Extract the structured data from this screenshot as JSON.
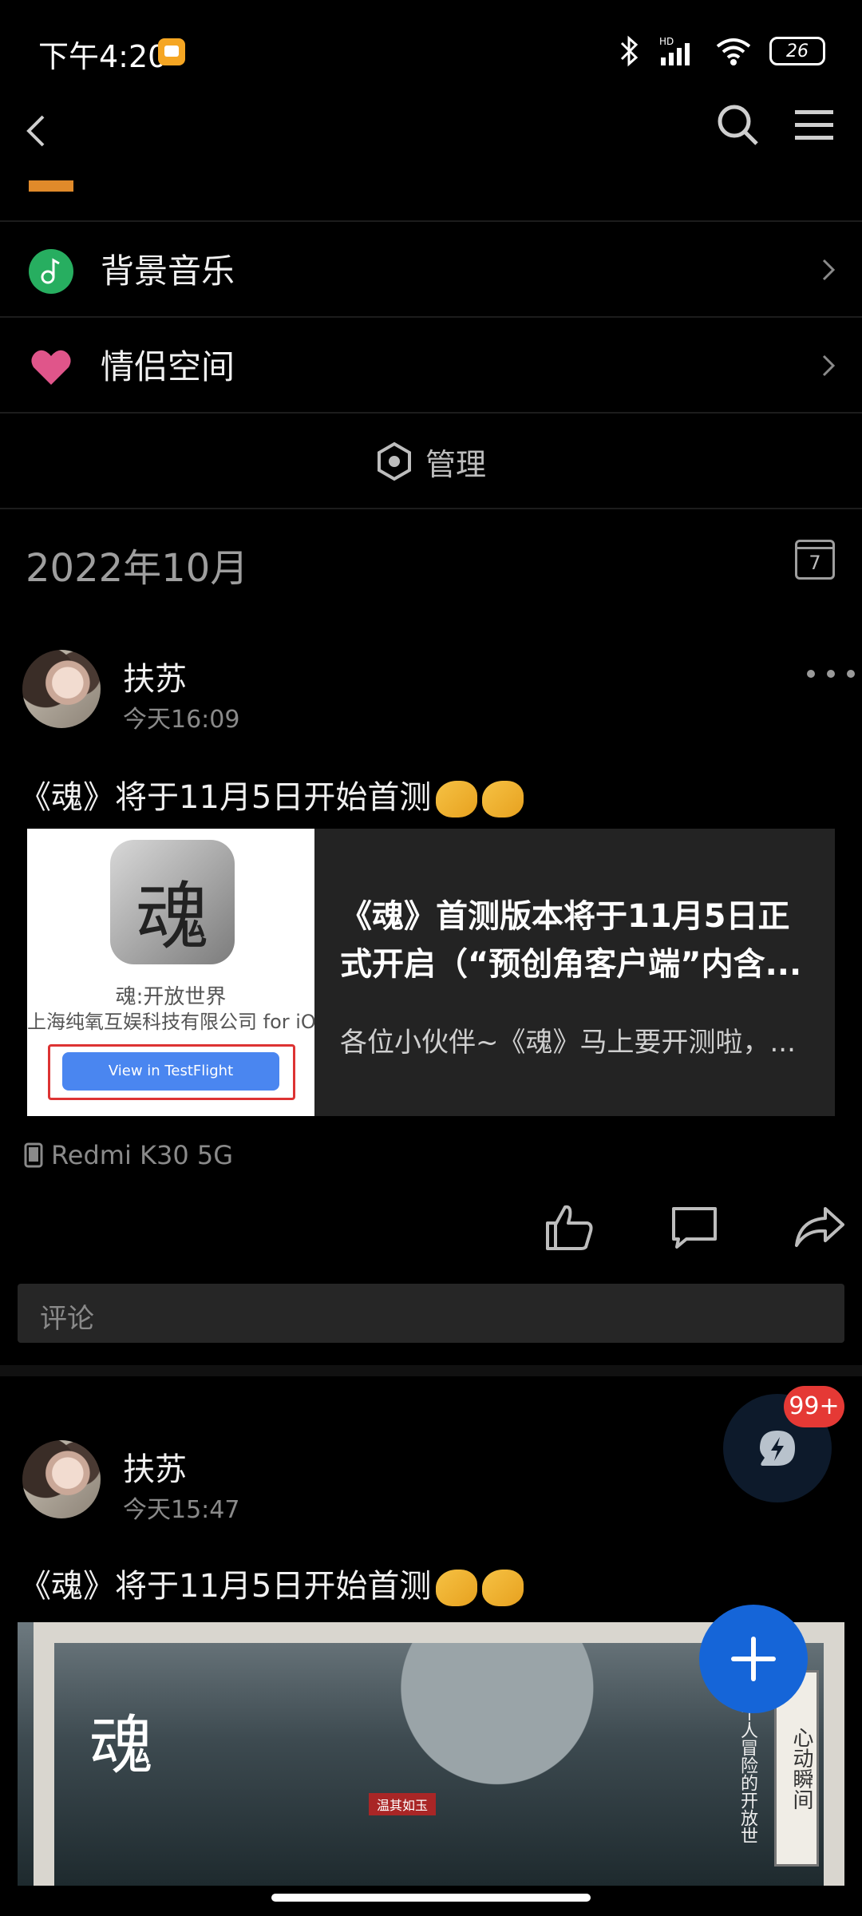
{
  "status_bar": {
    "time": "下午4:20",
    "battery": "26",
    "network": "HD"
  },
  "settings_rows": [
    {
      "label": "背景音乐",
      "icon": "music-note-icon",
      "color": "#27ae60"
    },
    {
      "label": "情侣空间",
      "icon": "heart-icon",
      "color": "#e0558a"
    }
  ],
  "manage": {
    "label": "管理"
  },
  "month": {
    "title": "2022年10月",
    "calendar_day": "7"
  },
  "posts": [
    {
      "author": "扶苏",
      "time": "今天16:09",
      "text": "《魂》将于11月5日开始首测",
      "link_card": {
        "thumb_app_glyph": "魂",
        "thumb_app_name": "魂:开放世界",
        "thumb_company": "上海纯氧互娱科技有限公司 for iOS",
        "thumb_button": "View in TestFlight",
        "title": "《魂》首测版本将于11月5日正式开启（“预创角客户端”内含...",
        "description": "各位小伙伴~《魂》马上要开测啦，..."
      },
      "device": "Redmi K30 5G",
      "comment_placeholder": "评论"
    },
    {
      "author": "扶苏",
      "time": "今天15:47",
      "text": "《魂》将于11月5日开始首测",
      "image": {
        "logo": "魂",
        "banner": "心动瞬间",
        "side_text": "一个人冒险的开放世",
        "name_tag": "温其如玉"
      }
    }
  ],
  "floating": {
    "chat_badge": "99+"
  },
  "colors": {
    "accent": "#1565d8",
    "badge": "#e53935",
    "background": "#000000"
  }
}
